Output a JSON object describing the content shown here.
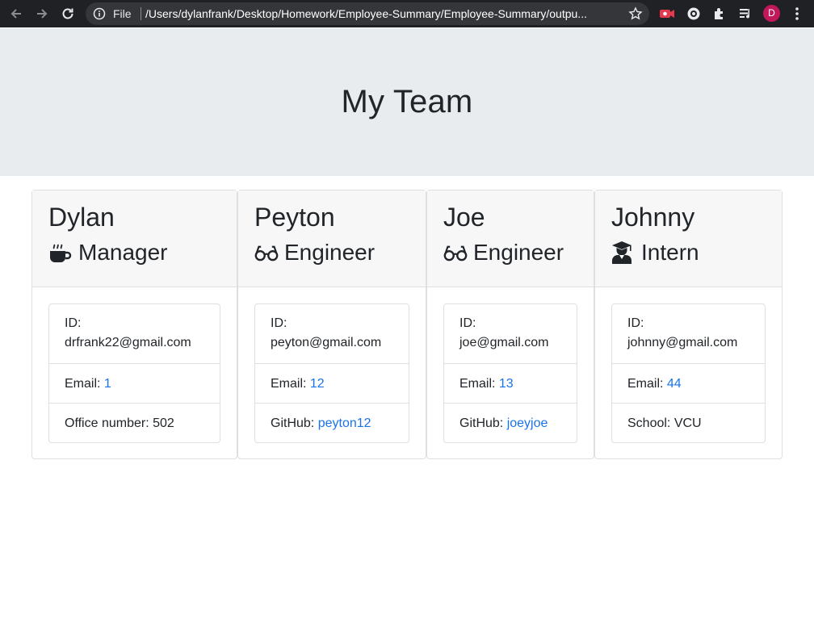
{
  "browser": {
    "scheme": "File",
    "url": "/Users/dylanfrank/Desktop/Homework/Employee-Summary/Employee-Summary/outpu...",
    "profile_initial": "D"
  },
  "page": {
    "title": "My Team"
  },
  "team": [
    {
      "name": "Dylan",
      "role": "Manager",
      "role_icon": "mug-icon",
      "id_label": "ID:",
      "id_value": "drfrank22@gmail.com",
      "email_label": "Email:",
      "email_value": "1",
      "extra_label": "Office number:",
      "extra_value": "502",
      "extra_is_link": false
    },
    {
      "name": "Peyton",
      "role": "Engineer",
      "role_icon": "glasses-icon",
      "id_label": "ID:",
      "id_value": "peyton@gmail.com",
      "email_label": "Email:",
      "email_value": "12",
      "extra_label": "GitHub:",
      "extra_value": "peyton12",
      "extra_is_link": true
    },
    {
      "name": "Joe",
      "role": "Engineer",
      "role_icon": "glasses-icon",
      "id_label": "ID:",
      "id_value": "joe@gmail.com",
      "email_label": "Email:",
      "email_value": "13",
      "extra_label": "GitHub:",
      "extra_value": "joeyjoe",
      "extra_is_link": true
    },
    {
      "name": "Johnny",
      "role": "Intern",
      "role_icon": "graduate-icon",
      "id_label": "ID:",
      "id_value": "johnny@gmail.com",
      "email_label": "Email:",
      "email_value": "44",
      "extra_label": "School:",
      "extra_value": "VCU",
      "extra_is_link": false
    }
  ],
  "colors": {
    "jumbotron": "#e9ecef",
    "link": "#1a73e8",
    "card_header": "#f7f7f7"
  }
}
